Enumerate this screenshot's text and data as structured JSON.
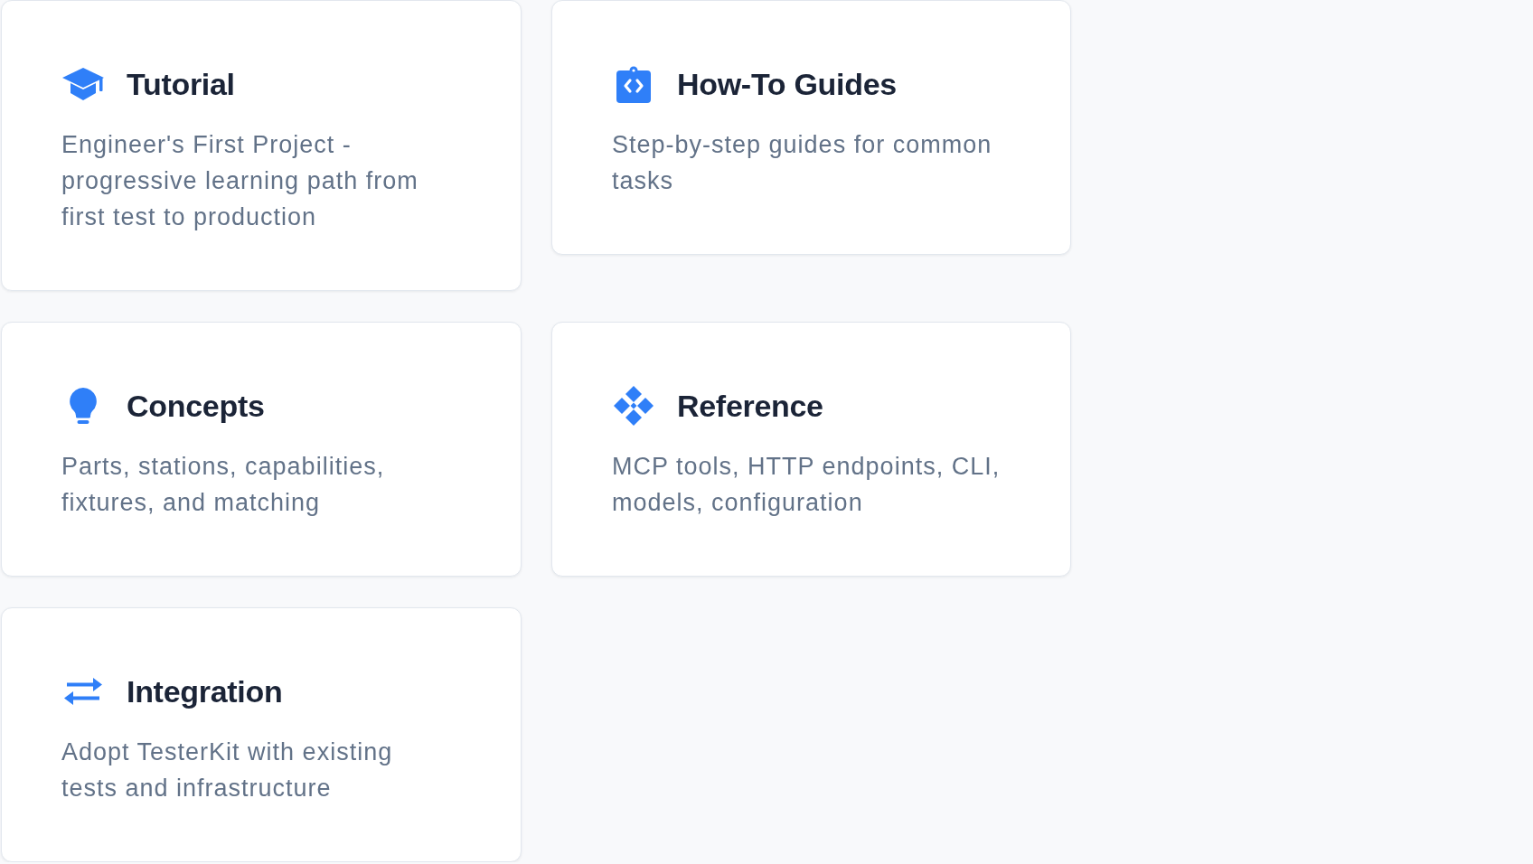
{
  "cards": [
    {
      "kind": "tutorial",
      "title": "Tutorial",
      "description": "Engineer's First Project - progressive learning path from first test to production"
    },
    {
      "kind": "guides",
      "title": "How-To Guides",
      "description": "Step-by-step guides for common tasks"
    },
    {
      "kind": "concepts",
      "title": "Concepts",
      "description": "Parts, stations, capabilities, fixtures, and matching"
    },
    {
      "kind": "reference",
      "title": "Reference",
      "description": "MCP tools, HTTP endpoints, CLI, models, configuration"
    },
    {
      "kind": "integration",
      "title": "Integration",
      "description": "Adopt TesterKit with existing tests and infrastructure"
    }
  ]
}
